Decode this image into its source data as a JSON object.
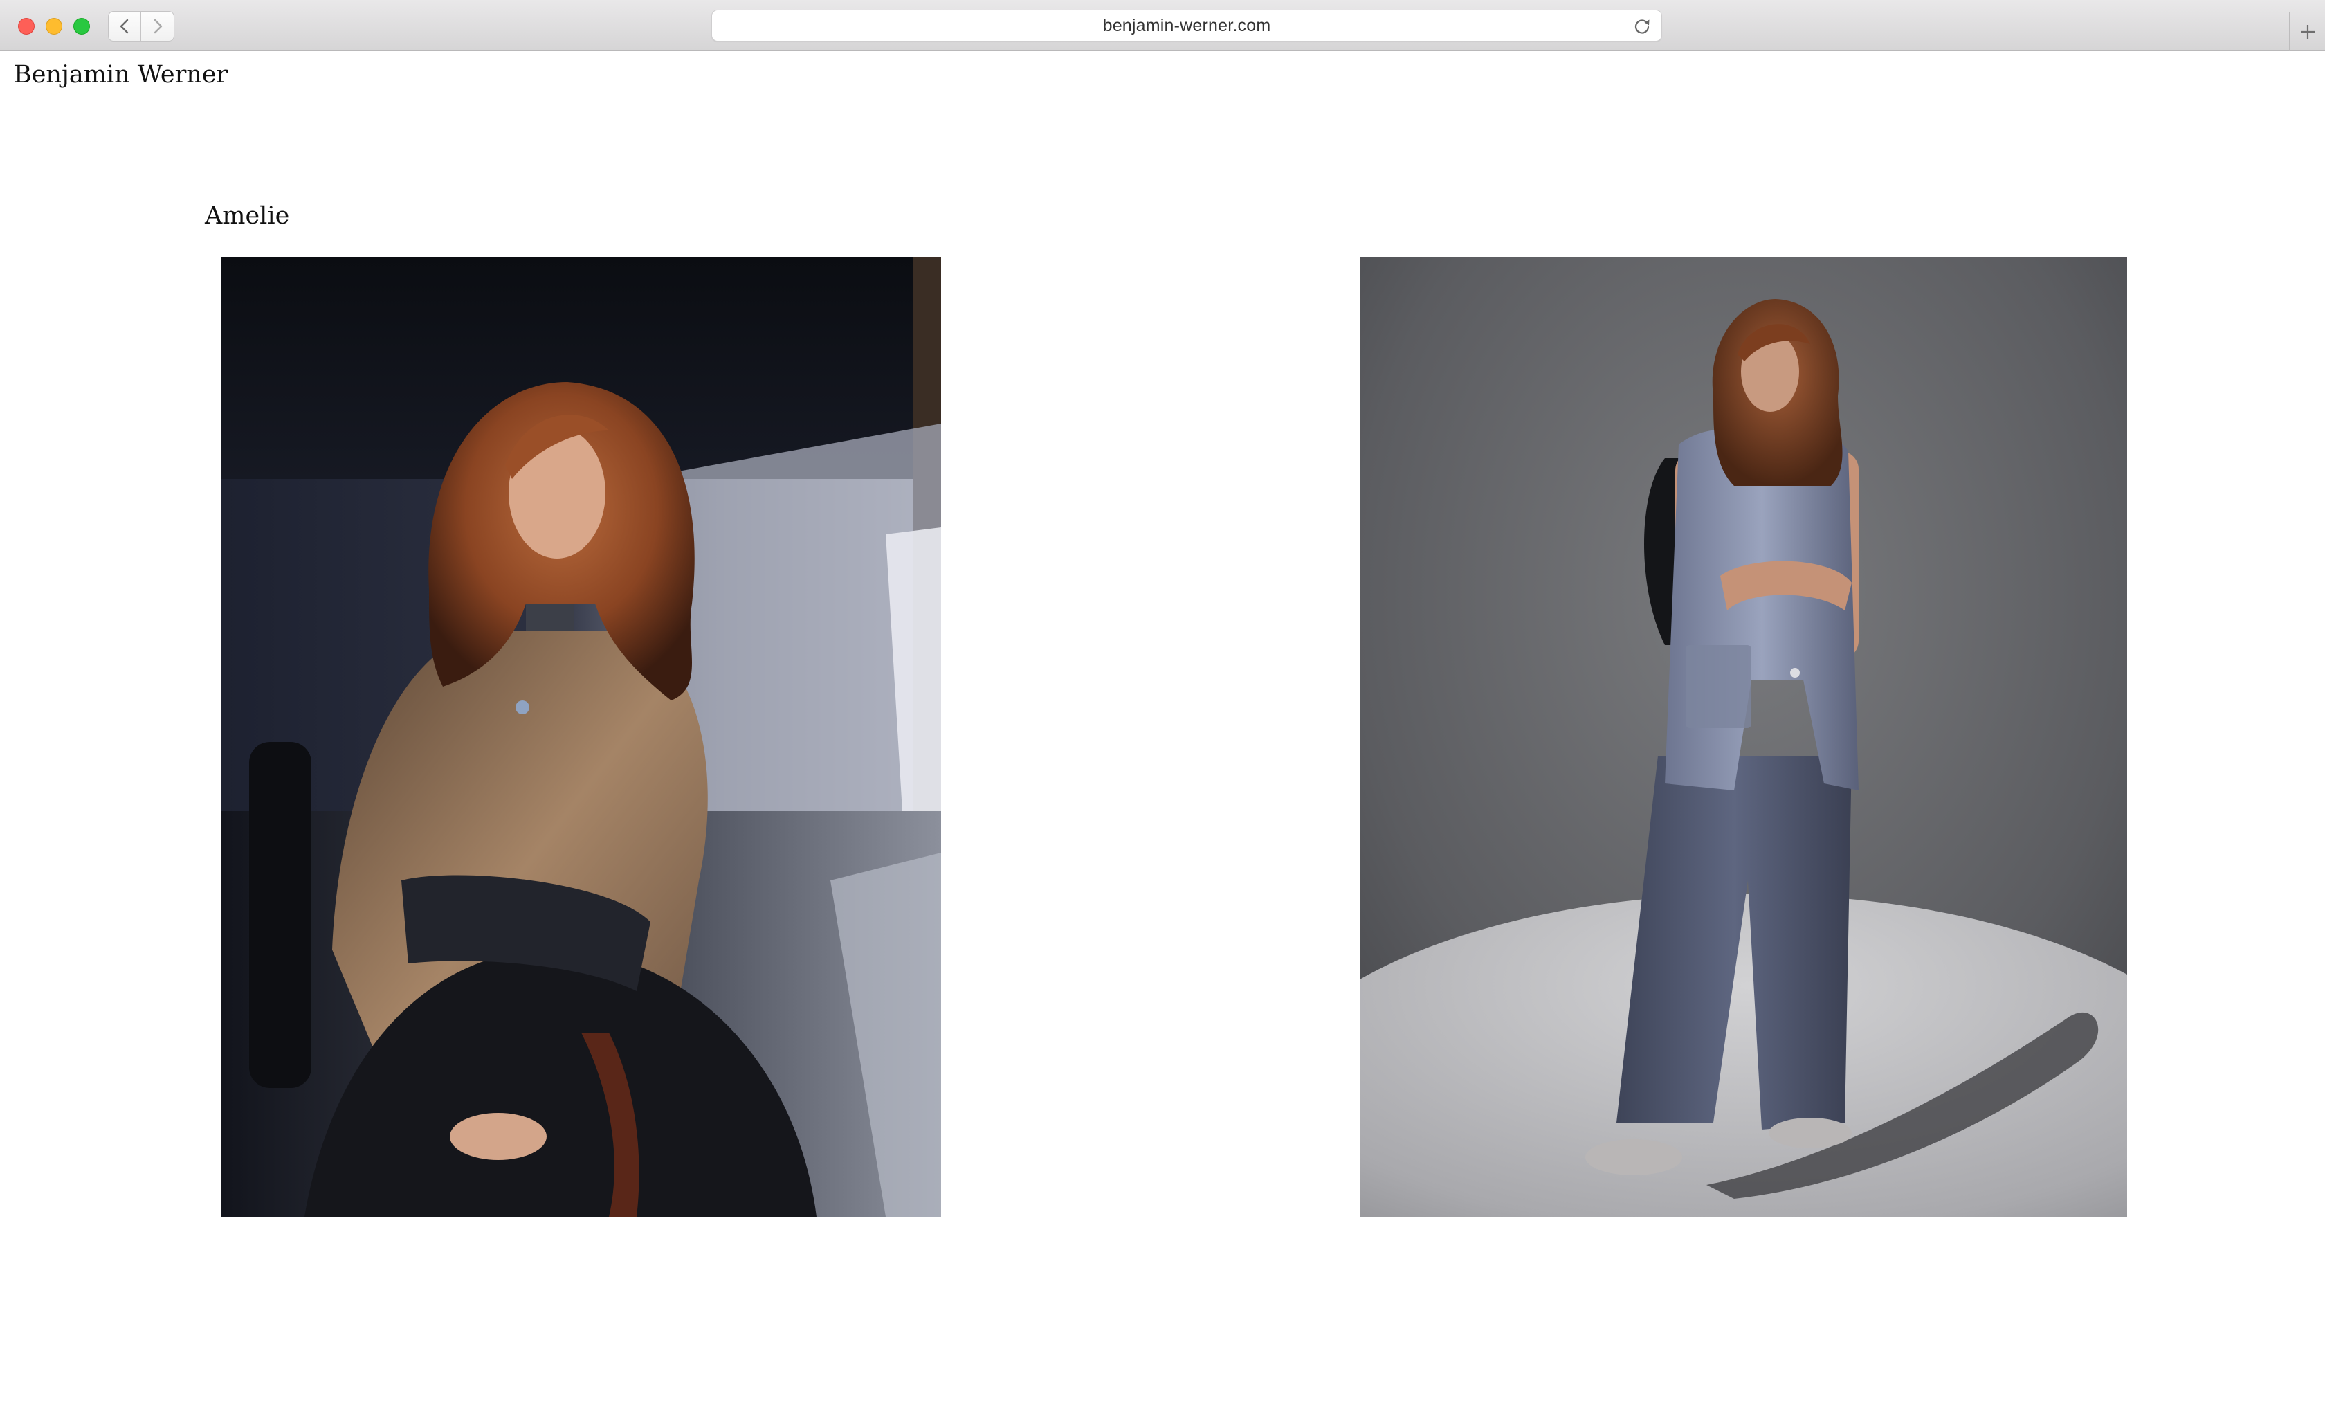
{
  "browser": {
    "url": "benjamin-werner.com"
  },
  "site": {
    "title": "Benjamin Werner"
  },
  "project": {
    "title": "Amelie"
  },
  "photos": [
    {
      "name": "photo-seated-portrait"
    },
    {
      "name": "photo-standing-full-length"
    }
  ]
}
